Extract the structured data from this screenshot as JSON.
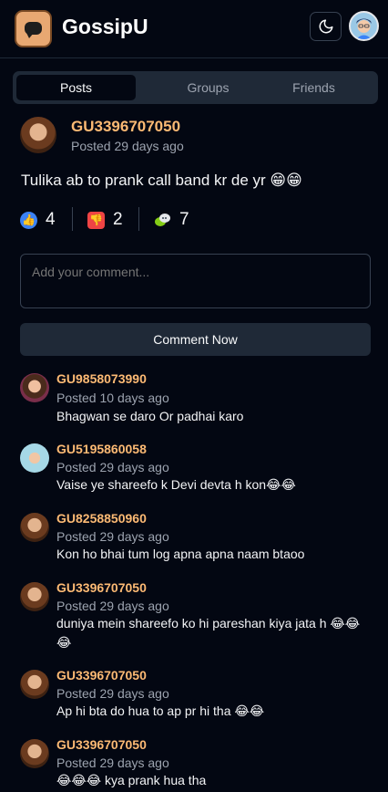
{
  "header": {
    "brand": "GossipU",
    "logo_icon": "chat-bubble-icon",
    "theme_icon": "moon-icon"
  },
  "tabs": [
    {
      "label": "Posts",
      "active": true
    },
    {
      "label": "Groups",
      "active": false
    },
    {
      "label": "Friends",
      "active": false
    }
  ],
  "post": {
    "user": "GU3396707050",
    "time": "Posted 29 days ago",
    "text": "Tulika ab to prank call band kr de yr 😁😁",
    "reactions": [
      {
        "icon": "thumbs-up-icon",
        "count": "4",
        "color": "#3b82f6"
      },
      {
        "icon": "thumbs-down-icon",
        "count": "2",
        "color": "#ef4444"
      },
      {
        "icon": "gossip-icon",
        "count": "7",
        "color": "#84cc16"
      }
    ]
  },
  "comment_form": {
    "placeholder": "Add your comment...",
    "button": "Comment Now"
  },
  "comments": [
    {
      "user": "GU9858073990",
      "time": "Posted 10 days ago",
      "text": "Bhagwan se daro Or padhai karo"
    },
    {
      "user": "GU5195860058",
      "time": "Posted 29 days ago",
      "text": "Vaise ye shareefo k Devi devta h kon😂😂"
    },
    {
      "user": "GU8258850960",
      "time": "Posted 29 days ago",
      "text": "Kon ho bhai tum log apna apna naam btaoo"
    },
    {
      "user": "GU3396707050",
      "time": "Posted 29 days ago",
      "text": "duniya mein shareefo ko hi pareshan kiya jata h 😂😂😂"
    },
    {
      "user": "GU3396707050",
      "time": "Posted 29 days ago",
      "text": "Ap hi bta do hua to ap pr hi tha 😂😂"
    },
    {
      "user": "GU3396707050",
      "time": "Posted 29 days ago",
      "text": "😂😂😂 kya prank hua tha"
    }
  ]
}
